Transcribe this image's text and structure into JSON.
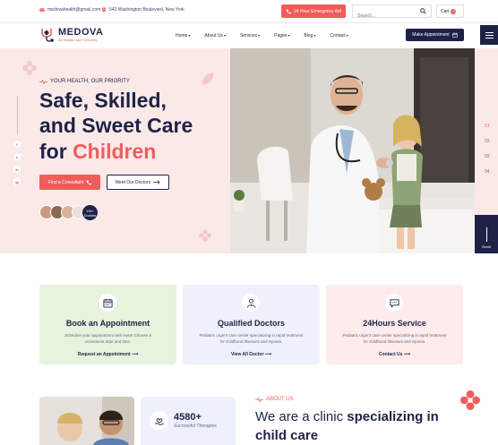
{
  "topbar": {
    "email": "medovahealth@gmail.com",
    "address": "542 Washington Boulevard, New York",
    "emergency": "24 Hour Emergency Aid",
    "search_placeholder": "Search...",
    "cart_label": "Cart",
    "cart_count": "0"
  },
  "brand": {
    "name": "MEDOVA",
    "tagline": "All Health Care Services"
  },
  "nav": {
    "items": [
      {
        "label": "Home"
      },
      {
        "label": "About Us"
      },
      {
        "label": "Services"
      },
      {
        "label": "Pages"
      },
      {
        "label": "Blog"
      },
      {
        "label": "Contact"
      }
    ],
    "cta": "Make Appointment"
  },
  "hero": {
    "eyebrow": "YOUR HEALTH, OUR PRIORITY",
    "line1": "Safe, Skilled,",
    "line2": "and Sweet Care",
    "line3_prefix": "for",
    "line3_accent": "Children",
    "btn_primary": "Find a Consultant",
    "btn_secondary": "Meet Our Doctors",
    "avatar_count": "12k+",
    "avatar_label": "Doctors",
    "slides": [
      "01",
      "02",
      "03",
      "04"
    ],
    "scroll_label": "Scroll"
  },
  "social": [
    "f",
    "x",
    "in",
    "ig"
  ],
  "features": [
    {
      "title": "Book an Appointment",
      "desc": "Schedule your appointment with ease! Choose a convenient date and time.",
      "link": "Request an Appointment"
    },
    {
      "title": "Qualified Doctors",
      "desc": "Pediatric urgent care center specializing in rapid treatment for childhood illnesses and injuries.",
      "link": "View All Doctor"
    },
    {
      "title": "24Hours Service",
      "desc": "Pediatric urgent care center specializing in rapid treatment for childhood illnesses and injuries.",
      "link": "Contact Us"
    }
  ],
  "about": {
    "stat_value": "4580+",
    "stat_label": "Successful Therapies",
    "eyebrow": "ABOUT US",
    "title_regular": "We are a clinic",
    "title_bold": "specializing in child care"
  },
  "colors": {
    "navy": "#1f2247",
    "accent": "#f15b5b",
    "hero_bg": "#fbe9e8",
    "card_green": "#e7f3dc",
    "card_lavender": "#eef0fb",
    "card_pink": "#fdeceb"
  }
}
